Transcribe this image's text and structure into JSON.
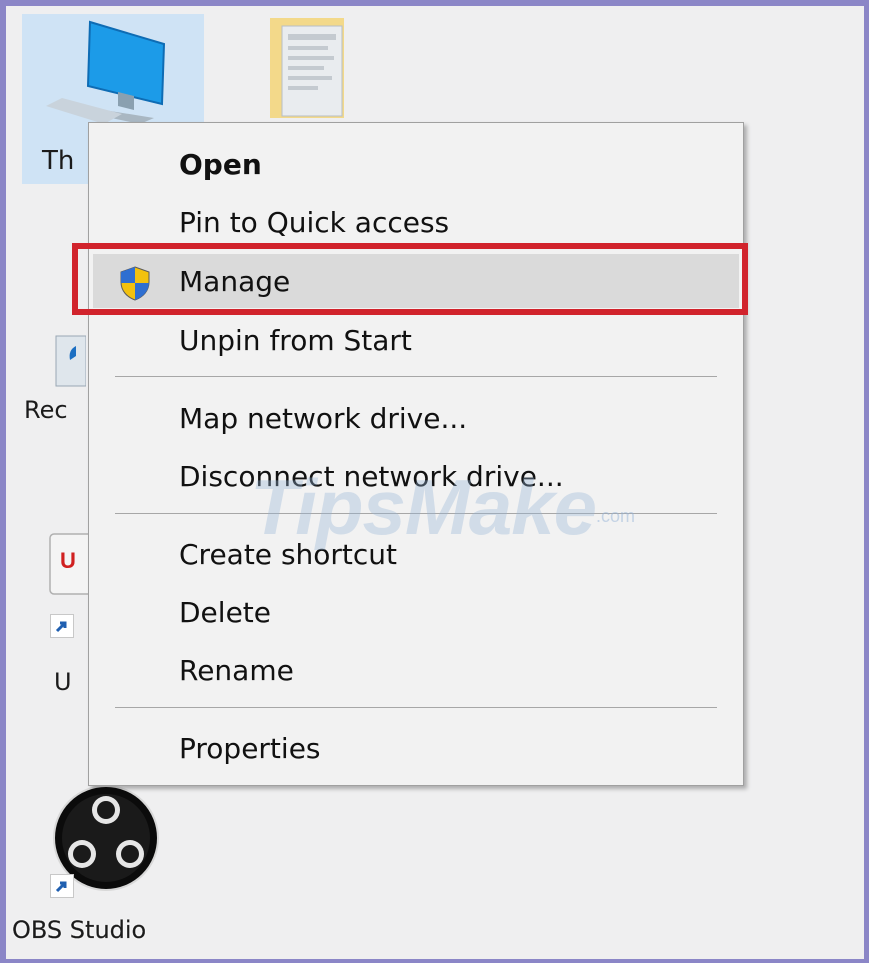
{
  "desktop": {
    "icons": [
      {
        "label": "Th",
        "name": "this-pc"
      },
      {
        "label": "Rec",
        "name": "recycle-bin"
      },
      {
        "label": "U",
        "name": "unikey"
      },
      {
        "label": "OBS Studio",
        "name": "obs-studio"
      }
    ]
  },
  "context_menu": {
    "items": [
      {
        "label": "Open",
        "bold": true
      },
      {
        "label": "Pin to Quick access"
      },
      {
        "label": "Manage",
        "icon": "uac-shield-icon",
        "highlighted": true
      },
      {
        "label": "Unpin from Start"
      },
      {
        "label": "Map network drive..."
      },
      {
        "label": "Disconnect network drive..."
      },
      {
        "label": "Create shortcut"
      },
      {
        "label": "Delete"
      },
      {
        "label": "Rename"
      },
      {
        "label": "Properties"
      }
    ]
  },
  "watermark": {
    "text": "TipsMake",
    "suffix": ".com"
  },
  "colors": {
    "highlight_box": "#d1232c",
    "frame_border": "#8b86c7",
    "selected_icon_bg": "#cfe3f5"
  }
}
